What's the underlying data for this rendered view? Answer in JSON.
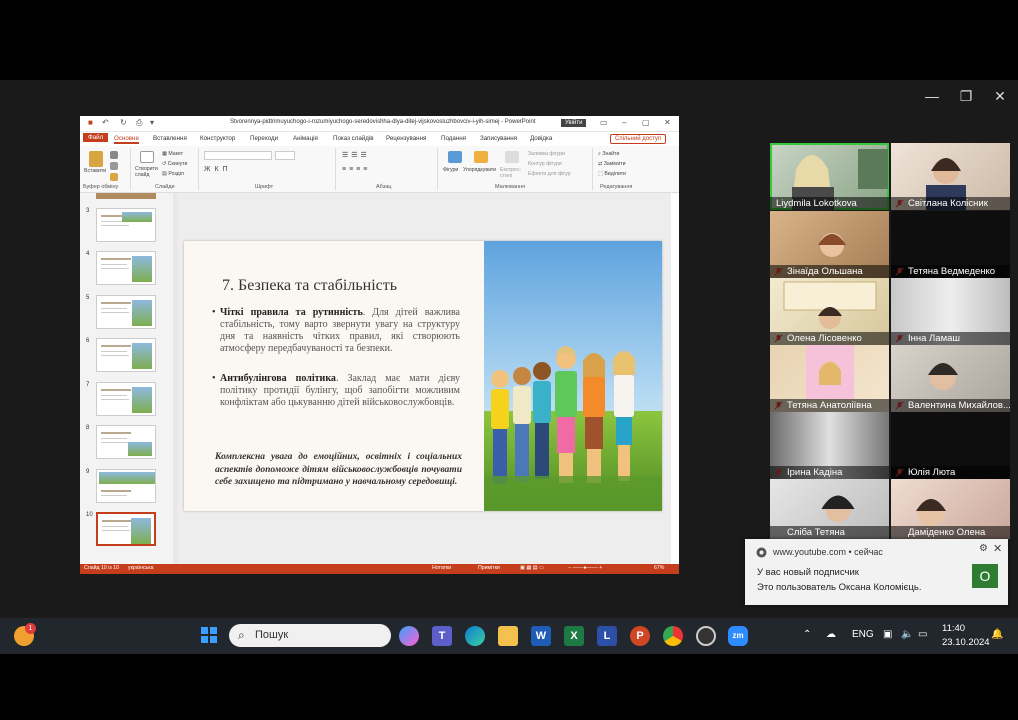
{
  "window_title": "Stvorennya-pidtrimuyuchogo-i-rozumiyuchogo-seredovishha-dlya-ditej-vijskovosluzhbovciv-i-yih-simej  -  PowerPoint",
  "sign_in": "Увійти",
  "ribbon_tabs": [
    "Файл",
    "Основне",
    "Вставлення",
    "Конструктор",
    "Переходи",
    "Анімація",
    "Показ слайдів",
    "Рецензування",
    "Подання",
    "Записування",
    "Довідка"
  ],
  "share_label": "Спільний доступ",
  "ribbon_groups": [
    "Буфер обміну",
    "Слайди",
    "Шрифт",
    "Абзац",
    "Малювання",
    "Редагування"
  ],
  "ribbon_buttons": {
    "paste": "Вставити",
    "new_slide": "Створити слайд",
    "layout": "Макет",
    "reset": "Скинути",
    "section": "Розділ",
    "shapes": "Фігури",
    "arrange": "Упорядкувати",
    "quick_styles": "Експрес-стилі",
    "shape_fill": "Заливка фігури",
    "shape_outline": "Контур фігури",
    "shape_effects": "Ефекти для фігур",
    "find": "Знайти",
    "replace": "Замінити",
    "select": "Виділити"
  },
  "thumbnails": [
    {
      "num": "3"
    },
    {
      "num": "4"
    },
    {
      "num": "5"
    },
    {
      "num": "6"
    },
    {
      "num": "7"
    },
    {
      "num": "8"
    },
    {
      "num": "9"
    },
    {
      "num": "10"
    }
  ],
  "slide": {
    "title": "7. Безпека та стабільність",
    "bullet1_bold": "Чіткі правила та рутинність",
    "bullet1_text": ". Для дітей важлива стабільність, тому варто звернути увагу на структуру дня та наявність чітких правил, які створюють атмосферу передбачуваності та безпеки.",
    "bullet2_bold": "Антибулінгова політика",
    "bullet2_text": ". Заклад має мати дієву політику протидії булінгу, щоб запобігти можливим конфліктам або цькуванню дітей військовослужбовців.",
    "conclusion": "Комплексна увага до емоційних, освітніх і соціальних аспектів допоможе дітям військовослужбовців почувати себе захищено та підтримано у навчальному середовищі."
  },
  "status_bar": {
    "slide": "Слайд 10 із 10",
    "language": "українська",
    "notes": "Нотатки",
    "comments": "Примітки",
    "zoom": "67%"
  },
  "participants": [
    {
      "name": "Liydmila Lokotkova",
      "active": true
    },
    {
      "name": "Світлана Колісник"
    },
    {
      "name": "Зінаїда Ольшана"
    },
    {
      "name": "Тетяна Ведмеденко"
    },
    {
      "name": "Олена Лісовенко"
    },
    {
      "name": "Інна Ламаш"
    },
    {
      "name": "Тетяна Анатоліївна"
    },
    {
      "name": "Валентина Михайлов..."
    },
    {
      "name": "Ірина Кадіна"
    },
    {
      "name": "Юлія Люта"
    },
    {
      "name": "Сліба Тетяна"
    },
    {
      "name": "Даміденко Олена"
    }
  ],
  "notification": {
    "source": "www.youtube.com • сейчас",
    "line1": "У вас новый подписчик",
    "line2": "Это пользователь Оксана Коломієць.",
    "badge": "О"
  },
  "taskbar": {
    "search_placeholder": "Пошук",
    "notification_count": "1",
    "lang": "ENG",
    "time": "11:40",
    "date": "23.10.2024"
  },
  "colors": {
    "ppt_accent": "#c43e1c",
    "active_speaker": "#37c73b",
    "taskbar": "#22262d"
  }
}
